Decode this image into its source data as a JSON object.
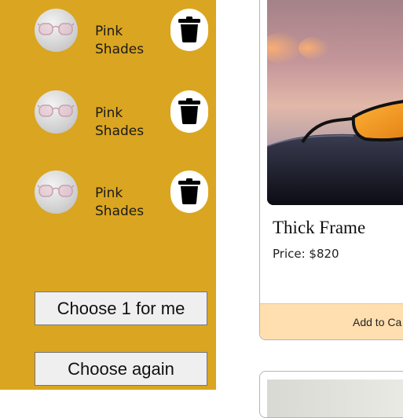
{
  "cart": {
    "items": [
      {
        "name": "Pink Shades",
        "thumb_icon": "glasses-icon",
        "delete_icon": "trash-icon"
      },
      {
        "name": "Pink Shades",
        "thumb_icon": "glasses-icon",
        "delete_icon": "trash-icon"
      },
      {
        "name": "Pink Shades",
        "thumb_icon": "glasses-icon",
        "delete_icon": "trash-icon"
      }
    ],
    "choose_one_label": "Choose 1 for me",
    "choose_again_label": "Choose again"
  },
  "product": {
    "title": "Thick Frame",
    "price": "Price: $820",
    "add_to_cart_label": "Add to Ca"
  },
  "colors": {
    "sidebar": "#daa520",
    "add_to_cart_bg": "#ffdfb0"
  }
}
